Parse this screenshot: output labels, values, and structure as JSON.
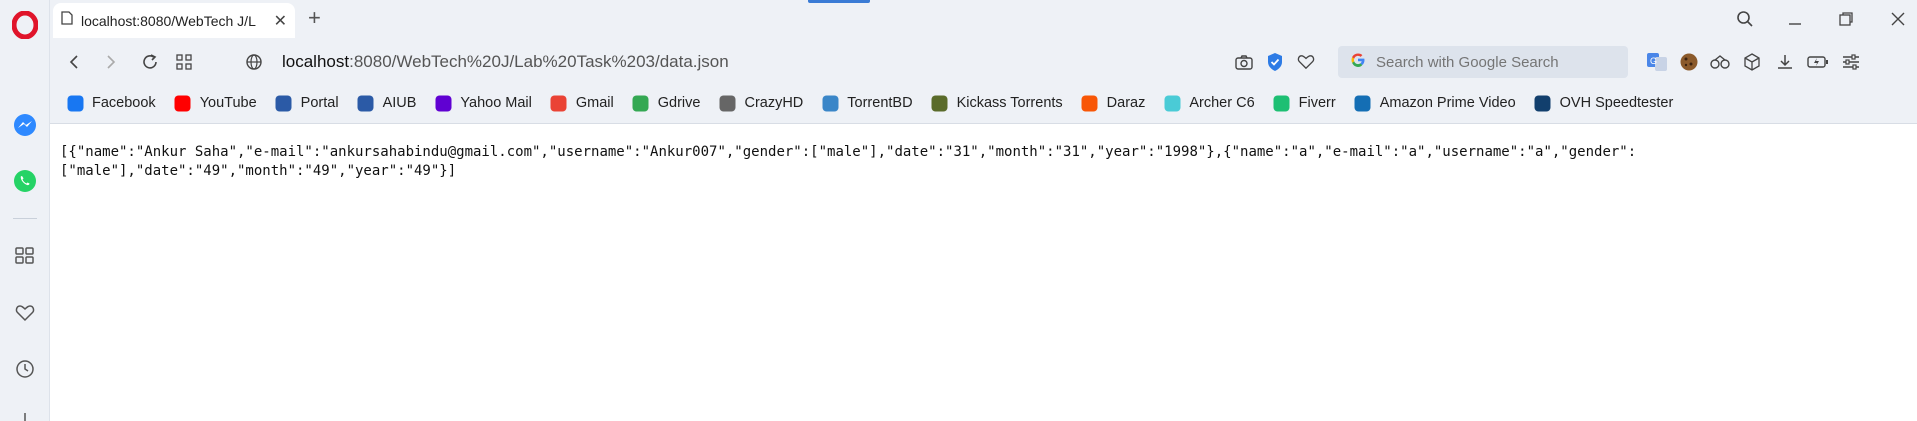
{
  "tab": {
    "title": "localhost:8080/WebTech J/L",
    "close": "✕",
    "new": "+"
  },
  "address": {
    "host": "localhost",
    "path": ":8080/WebTech%20J/Lab%20Task%203/data.json"
  },
  "search": {
    "placeholder": "Search with Google Search"
  },
  "bookmarks": [
    {
      "label": "Facebook",
      "icon": "facebook-icon",
      "color": "#1877f2"
    },
    {
      "label": "YouTube",
      "icon": "youtube-icon",
      "color": "#ff0000"
    },
    {
      "label": "Portal",
      "icon": "portal-icon",
      "color": "#2b5aa6"
    },
    {
      "label": "AIUB",
      "icon": "aiub-icon",
      "color": "#2b5aa6"
    },
    {
      "label": "Yahoo Mail",
      "icon": "yahoo-mail-icon",
      "color": "#6001d2"
    },
    {
      "label": "Gmail",
      "icon": "gmail-icon",
      "color": "#ea4335"
    },
    {
      "label": "Gdrive",
      "icon": "gdrive-icon",
      "color": "#34a853"
    },
    {
      "label": "CrazyHD",
      "icon": "document-icon",
      "color": "#666666"
    },
    {
      "label": "TorrentBD",
      "icon": "torrentbd-icon",
      "color": "#3a86c8"
    },
    {
      "label": "Kickass Torrents",
      "icon": "kickass-icon",
      "color": "#5a6b2a"
    },
    {
      "label": "Daraz",
      "icon": "daraz-icon",
      "color": "#f85606"
    },
    {
      "label": "Archer C6",
      "icon": "tplink-icon",
      "color": "#4acbd6"
    },
    {
      "label": "Fiverr",
      "icon": "fiverr-icon",
      "color": "#1dbf73"
    },
    {
      "label": "Amazon Prime Video",
      "icon": "prime-video-icon",
      "color": "#146eb4"
    },
    {
      "label": "OVH Speedtester",
      "icon": "ovh-icon",
      "color": "#123f6d"
    }
  ],
  "content": {
    "json_text": "[{\"name\":\"Ankur Saha\",\"e-mail\":\"ankursahabindu@gmail.com\",\"username\":\"Ankur007\",\"gender\":[\"male\"],\"date\":\"31\",\"month\":\"31\",\"year\":\"1998\"},{\"name\":\"a\",\"e-mail\":\"a\",\"username\":\"a\",\"gender\":\n[\"male\"],\"date\":\"49\",\"month\":\"49\",\"year\":\"49\"}]"
  },
  "colors": {
    "opera_red": "#e0142a",
    "accent_blue": "#3a7bd5",
    "messenger": "#0084ff",
    "whatsapp": "#25d366"
  }
}
